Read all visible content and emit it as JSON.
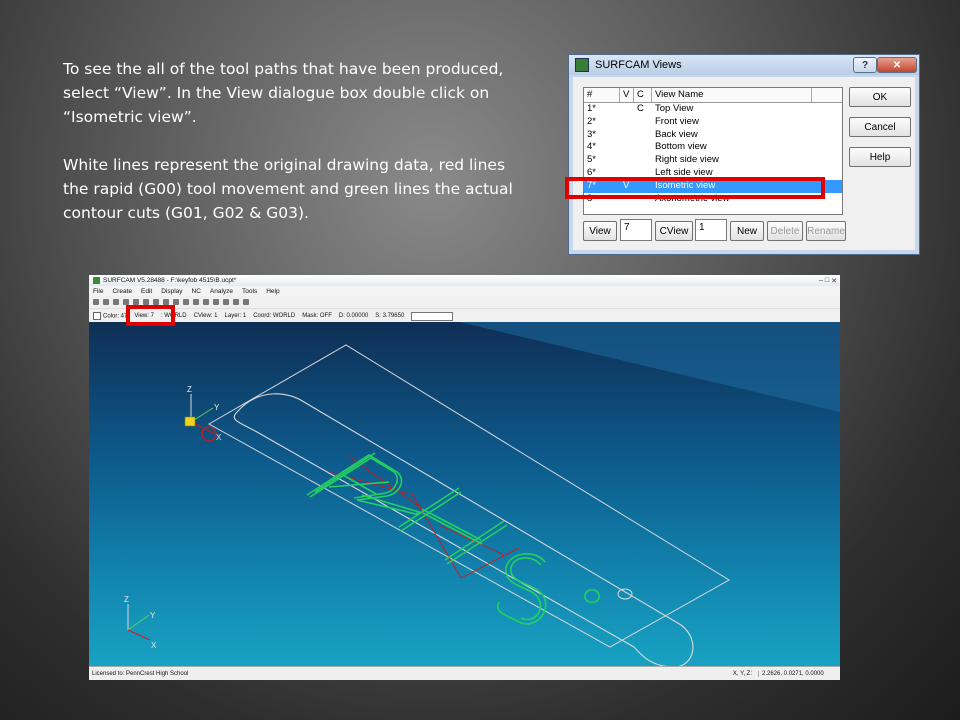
{
  "instructions": {
    "paragraph1": "To see the all of the tool paths that have been produced, select “View”. In the View dialogue box double click on “Isometric view”.",
    "paragraph2": "White lines represent the original drawing data, red lines the rapid (G00) tool movement and green lines the actual contour cuts (G01, G02 & G03)."
  },
  "views_dialog": {
    "title": "SURFCAM Views",
    "help_glyph": "?",
    "close_glyph": "✕",
    "columns": [
      "#",
      "V",
      "C",
      "View Name"
    ],
    "rows": [
      {
        "num": "1*",
        "v": "",
        "c": "C",
        "name": "Top View"
      },
      {
        "num": "2*",
        "v": "",
        "c": "",
        "name": "Front view"
      },
      {
        "num": "3*",
        "v": "",
        "c": "",
        "name": "Back view"
      },
      {
        "num": "4*",
        "v": "",
        "c": "",
        "name": "Bottom view"
      },
      {
        "num": "5*",
        "v": "",
        "c": "",
        "name": "Right side view"
      },
      {
        "num": "6*",
        "v": "",
        "c": "",
        "name": "Left side view"
      },
      {
        "num": "7*",
        "v": "V",
        "c": "",
        "name": "Isometric view"
      },
      {
        "num": "8*",
        "v": "",
        "c": "",
        "name": "Axonometric view"
      }
    ],
    "selected_row": 6,
    "buttons": {
      "ok": "OK",
      "cancel": "Cancel",
      "help": "Help"
    },
    "bottom": {
      "view_label": "View",
      "view_value": "7",
      "cview_label": "CView",
      "cview_value": "1",
      "new_label": "New",
      "delete_label": "Delete",
      "rename_label": "Rename"
    }
  },
  "surfcam": {
    "title": "SURFCAM V5.28488 - F:\\keyfob 4515\\B.ucpt*",
    "menu": [
      "File",
      "Create",
      "Edit",
      "Display",
      "NC",
      "Analyze",
      "Tools",
      "Help"
    ],
    "toolbar2": {
      "color": "Color: 47",
      "view": "View: 7",
      "cplane": ": WORLD",
      "cview": "CView: 1",
      "layer": "Layer: 1",
      "coord": "Coord: WORLD",
      "mask": "Mask: OFF",
      "d": "D: 0.00000",
      "s": "S: 3.79650"
    },
    "status_left": "Licensed to: PennCrest High School",
    "status_xyz_label": "X, Y, Z:",
    "status_xyz_value": "2.2626, 0.0271, 0.0000",
    "axis_labels": {
      "z": "Z",
      "y": "Y",
      "x": "X"
    },
    "colors": {
      "drawing": "#d8d8d8",
      "rapid": "#d01818",
      "contour": "#23d060"
    }
  }
}
